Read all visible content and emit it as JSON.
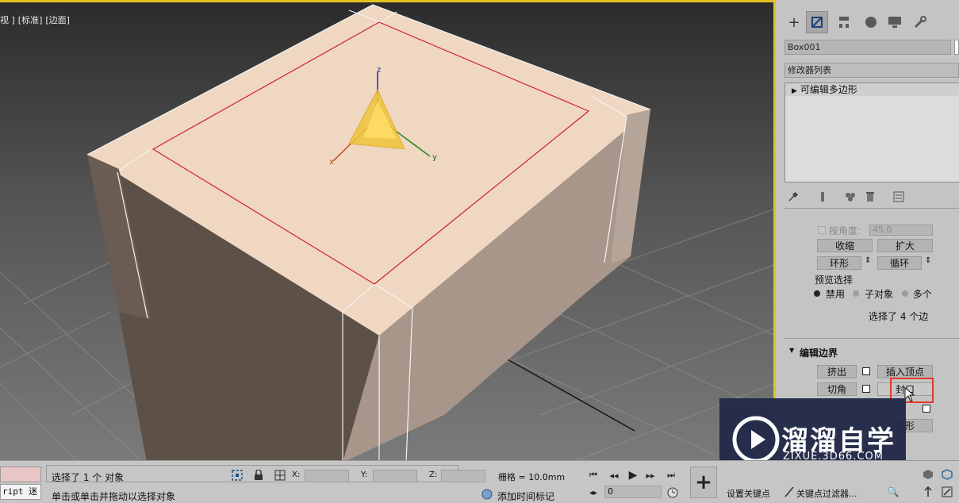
{
  "viewport": {
    "labels": [
      "视 ]",
      "[标准]",
      "[边面]"
    ],
    "gizmo_axes": {
      "x": "x",
      "y": "y",
      "z": "z"
    }
  },
  "cmdpanel": {
    "tabs": [
      "plus-icon",
      "modify-icon",
      "hierarchy-icon",
      "motion-icon",
      "display-icon",
      "utilities-icon"
    ],
    "object_name": "Box001",
    "modifier_list": "修改器列表",
    "stack_item": "可编辑多边形",
    "by_angle_label": "按角度:",
    "by_angle_value": "45.0",
    "shrink": "收缩",
    "grow": "扩大",
    "ring": "环形",
    "loop": "循环",
    "preview_selection": "预览选择",
    "preview_options": [
      "禁用",
      "子对象",
      "多个"
    ],
    "selection_status": "选择了 4 个边",
    "edit_borders_title": "编辑边界",
    "extrude": "挤出",
    "insert_vertex": "插入顶点",
    "chamfer": "切角",
    "cap": "封口",
    "shape": "图形"
  },
  "watermark": {
    "brand": "溜溜自学",
    "url": "ZIXUE.3D66.COM"
  },
  "statusbar": {
    "script_label": "ript 迷",
    "selection_text": "选择了 1 个 对象",
    "hint_text": "单击或单击并拖动以选择对象",
    "x_label": "X:",
    "y_label": "Y:",
    "z_label": "Z:",
    "grid_text": "栅格 = 10.0mm",
    "add_time_tag": "添加时间标记",
    "frame_value": "0",
    "set_key": "设置关键点",
    "key_filters": "关键点过滤器..."
  },
  "colors": {
    "viewport_border": "#e3c224",
    "box_top": "#efd7c2",
    "box_left": "#5d5046",
    "box_right": "#a8968a",
    "selection_edges": "#d0202a",
    "highlight": "#e23a2a"
  }
}
